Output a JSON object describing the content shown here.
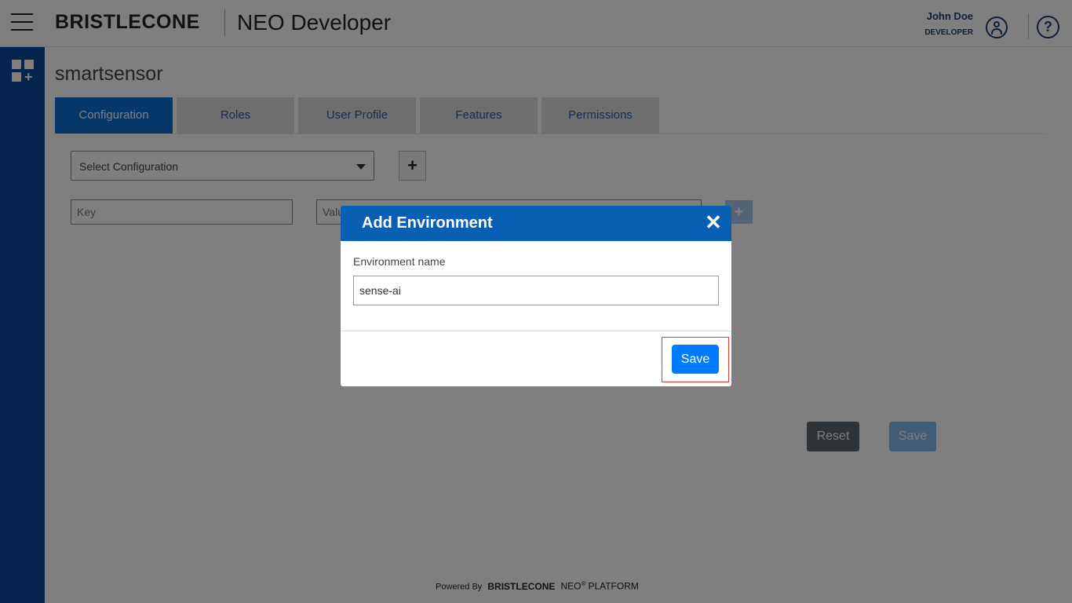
{
  "header": {
    "logo_text": "BRISTLECONE",
    "app_title": "NEO Developer",
    "user_name": "John Doe",
    "user_role": "DEVELOPER",
    "help_label": "?"
  },
  "sidebar": {
    "icons": [
      "menu-icon",
      "apps-add-icon"
    ]
  },
  "main": {
    "page_title": "smartsensor",
    "tabs": [
      {
        "label": "Configuration",
        "active": true
      },
      {
        "label": "Roles",
        "active": false
      },
      {
        "label": "User Profile",
        "active": false
      },
      {
        "label": "Features",
        "active": false
      },
      {
        "label": "Permissions",
        "active": false
      }
    ],
    "config_select": {
      "value": "Select Configuration"
    },
    "add_config_label": "+",
    "key_input": {
      "placeholder": "Key"
    },
    "value_input": {
      "placeholder": "Value"
    },
    "add_kv_label": "+",
    "reset_label": "Reset",
    "save_label": "Save"
  },
  "footer": {
    "powered_by": "Powered By",
    "brand": "BRISTLECONE",
    "neo": "NEO",
    "registered": "®",
    "platform": "PLATFORM"
  },
  "modal": {
    "title": "Add Environment",
    "close_label": "✕",
    "field_label": "Environment name",
    "field_value": "sense-ai",
    "save_label": "Save"
  },
  "colors": {
    "brand_blue": "#0a5fb4",
    "active_tab": "#0a6ed1",
    "sidebar": "#0b4a9c",
    "primary_button": "#007bff",
    "highlight": "#ee3333"
  }
}
